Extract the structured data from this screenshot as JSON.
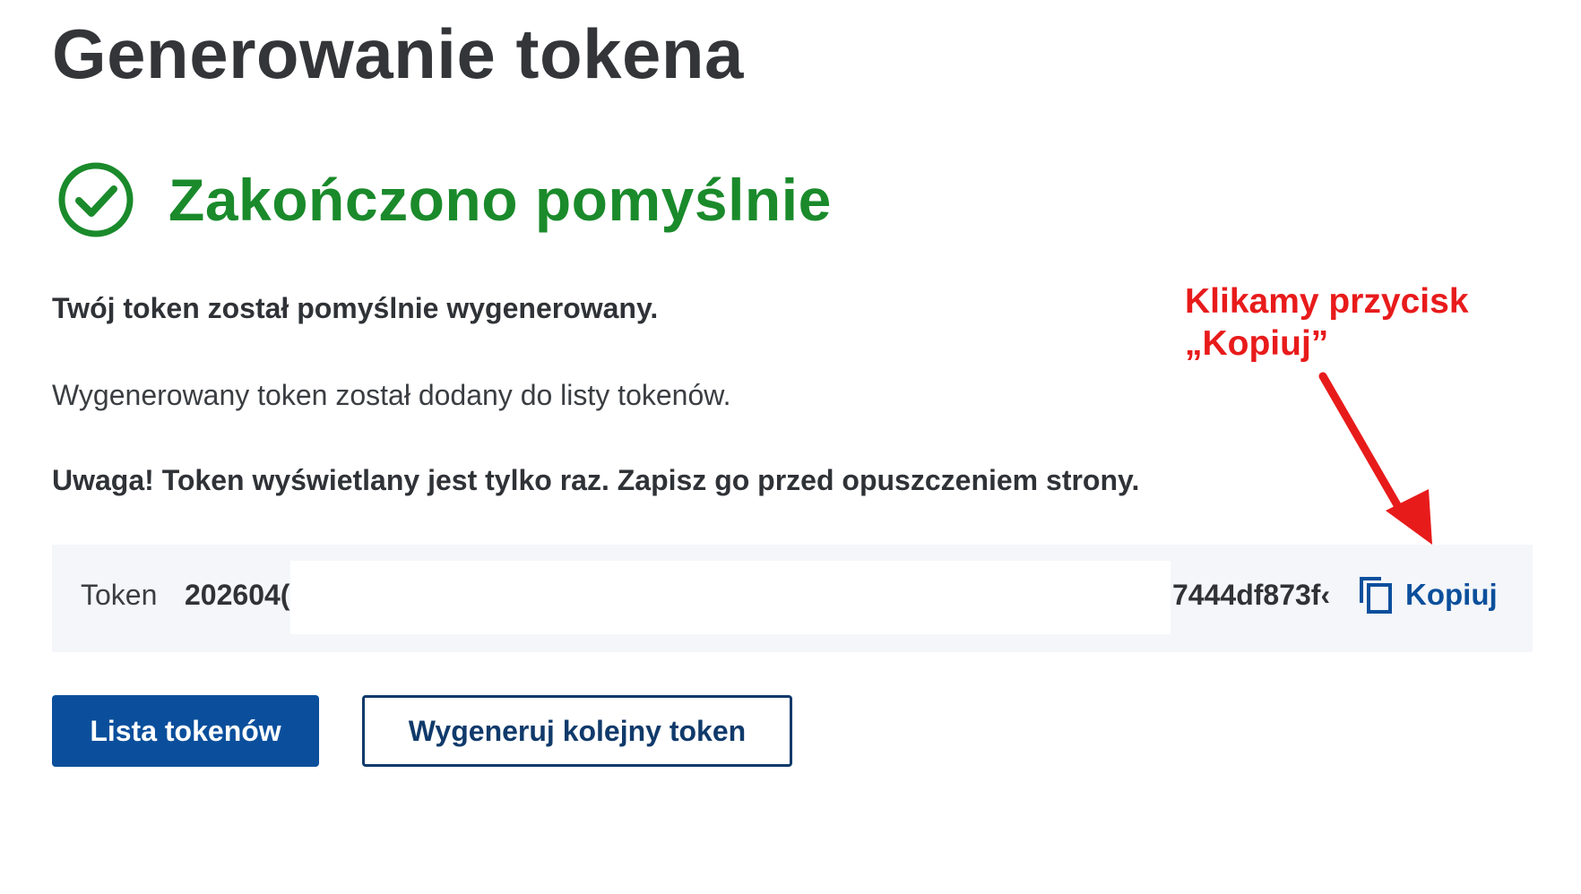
{
  "page": {
    "title": "Generowanie tokena"
  },
  "status": {
    "title": "Zakończono pomyślnie",
    "icon": "check-circle-icon",
    "color": "#1a8a2b"
  },
  "messages": {
    "lead": "Twój token został pomyślnie wygenerowany.",
    "info": "Wygenerowany token został dodany do listy tokenów.",
    "warning": "Uwaga! Token wyświetlany jest tylko raz. Zapisz go przed opuszczeniem strony."
  },
  "token": {
    "label": "Token",
    "visible_start": "202604(",
    "visible_end": "7444df873f‹",
    "copy_label": "Kopiuj",
    "copy_icon": "copy-icon"
  },
  "actions": {
    "primary_label": "Lista tokenów",
    "secondary_label": "Wygeneruj kolejny token"
  },
  "annotation": {
    "line1": "Klikamy przycisk",
    "line2": "„Kopiuj”",
    "color": "#e81b1b"
  },
  "colors": {
    "brand_blue": "#0b4f9c",
    "dark_navy": "#103a6b",
    "token_bg": "#f4f6f9"
  }
}
